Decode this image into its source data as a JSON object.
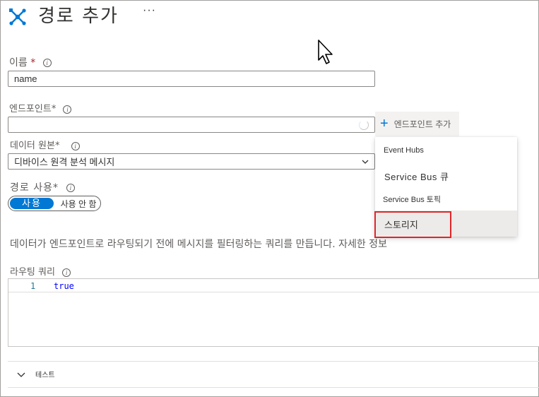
{
  "header": {
    "title": "경로 추가",
    "more": "···"
  },
  "form": {
    "name": {
      "label": "이름",
      "required_mark": "*",
      "value": "name"
    },
    "endpoint": {
      "label": "엔드포인트",
      "required_mark": "*",
      "value": "",
      "add_button_label": "엔드포인트 추가"
    },
    "data_source": {
      "label": "데이터 원본",
      "required_mark": "*",
      "selected": "디바이스 원격 분석 메시지"
    },
    "enable_route": {
      "label": "경로 사용",
      "required_mark": "*",
      "on_label": "사용",
      "off_label": "사용 안 함",
      "state": "on"
    },
    "description": "데이터가 엔드포인트로 라우팅되기 전에 메시지를 필터링하는 쿼리를 만듭니다.",
    "learn_more": "자세한 정보",
    "query": {
      "label": "라우팅 쿼리",
      "line_number": "1",
      "code": "true"
    },
    "test": {
      "label": "테스트"
    }
  },
  "endpoint_menu": {
    "items": [
      {
        "label": "Event Hubs"
      },
      {
        "label": "Service Bus 큐"
      },
      {
        "label": "Service Bus 토픽"
      },
      {
        "label": "스토리지",
        "highlighted": true
      }
    ]
  },
  "colors": {
    "accent": "#0078d4",
    "highlight_border": "#e0262b",
    "required": "#a4262c"
  },
  "icons": {
    "title": "route-icon",
    "info": "info-icon",
    "plus": "plus-icon",
    "dropdown": "chevron-down-icon",
    "expand": "chevron-down-icon"
  }
}
